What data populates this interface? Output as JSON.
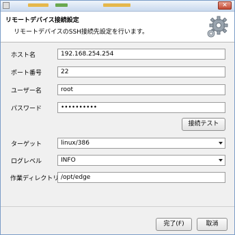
{
  "window": {
    "close_glyph": "✕"
  },
  "header": {
    "title": "リモートデバイス接続設定",
    "description": "リモートデバイスのSSH接続先設定を行います。",
    "icon": "gear-icon"
  },
  "form": {
    "host": {
      "label": "ホスト名",
      "value": "192.168.254.254"
    },
    "port": {
      "label": "ポート番号",
      "value": "22"
    },
    "user": {
      "label": "ユーザー名",
      "value": "root"
    },
    "password": {
      "label": "パスワード",
      "value": "••••••••••"
    },
    "test_button": "接続テスト",
    "target": {
      "label": "ターゲット",
      "value": "linux/386"
    },
    "loglevel": {
      "label": "ログレベル",
      "value": "INFO"
    },
    "workdir": {
      "label": "作業ディレクトリ",
      "value": "/opt/edge"
    }
  },
  "footer": {
    "finish_label": "完了(F)",
    "cancel_label": "取消"
  },
  "colors": {
    "accent": "#7a9cc6",
    "close": "#c34a33"
  }
}
